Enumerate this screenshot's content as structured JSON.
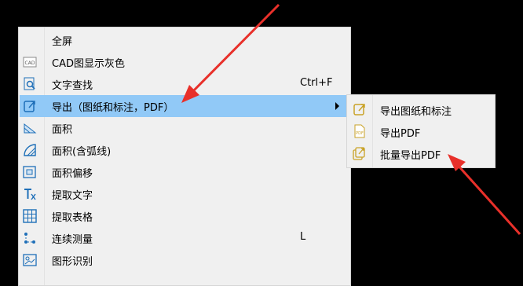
{
  "menu": {
    "items": [
      {
        "label": "全屏",
        "icon": "none",
        "shortcut": ""
      },
      {
        "label": "CAD图显示灰色",
        "icon": "cad-gray-icon",
        "shortcut": ""
      },
      {
        "label": "文字查找",
        "icon": "text-search-icon",
        "shortcut": "Ctrl+F"
      },
      {
        "label": "导出（图纸和标注，PDF）",
        "icon": "export-icon",
        "shortcut": ""
      },
      {
        "label": "面积",
        "icon": "area-icon",
        "shortcut": ""
      },
      {
        "label": "面积(含弧线)",
        "icon": "area-arc-icon",
        "shortcut": ""
      },
      {
        "label": "面积偏移",
        "icon": "area-offset-icon",
        "shortcut": ""
      },
      {
        "label": "提取文字",
        "icon": "extract-text-icon",
        "shortcut": ""
      },
      {
        "label": "提取表格",
        "icon": "extract-table-icon",
        "shortcut": ""
      },
      {
        "label": "连续测量",
        "icon": "continuous-measure-icon",
        "shortcut": "L"
      },
      {
        "label": "图形识别",
        "icon": "shape-recognition-icon",
        "shortcut": ""
      }
    ]
  },
  "submenu": {
    "items": [
      {
        "label": "导出图纸和标注",
        "icon": "export-drawing-icon"
      },
      {
        "label": "导出PDF",
        "icon": "pdf-icon"
      },
      {
        "label": "批量导出PDF",
        "icon": "batch-export-icon"
      }
    ]
  },
  "colors": {
    "highlight": "#91c9f7",
    "annotation_arrow": "#e8302a",
    "icon_accent": "#1e6fb8"
  }
}
